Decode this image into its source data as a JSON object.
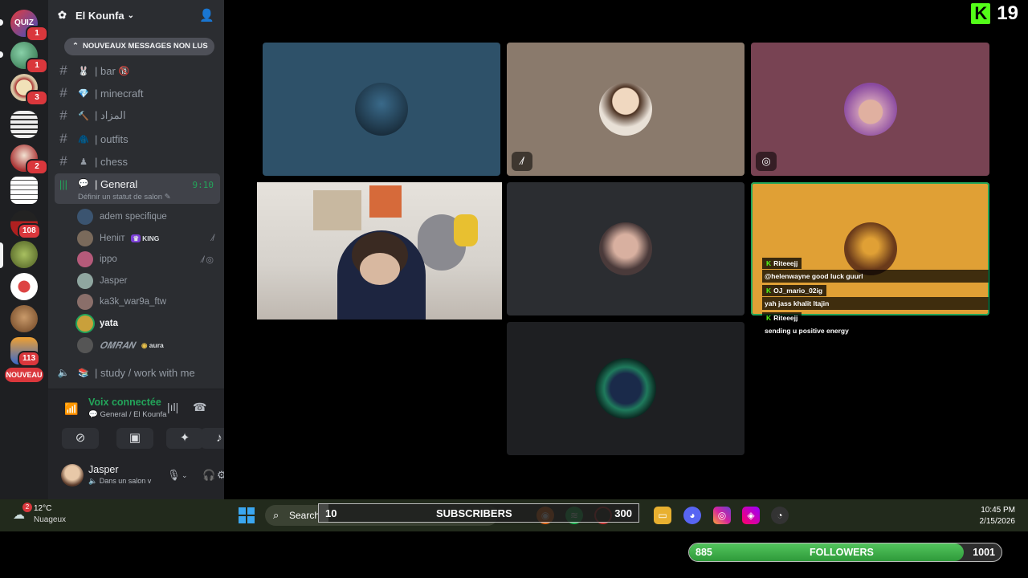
{
  "server_rail": {
    "badges": [
      "1",
      "1",
      "3",
      "2",
      "108",
      "113"
    ],
    "nouveau_label": "NOUVEAU",
    "quiz_label": "QUIZ"
  },
  "server": {
    "name": "El Kounfa",
    "unread_banner": "NOUVEAUX MESSAGES NON LUS"
  },
  "channels": [
    {
      "name": "| bar",
      "emoji": "🐰",
      "badge_emoji": "🔞"
    },
    {
      "name": "| minecraft",
      "emoji": "💎"
    },
    {
      "name": "| المزاد",
      "emoji": "🔨"
    },
    {
      "name": "| outfits",
      "emoji": "🧥"
    },
    {
      "name": "| chess",
      "emoji": "♟"
    }
  ],
  "voice_channel": {
    "name": "| General",
    "timer": "9:10",
    "status_hint": "Définir un statut de salon",
    "members": [
      {
        "name": "adem specifique",
        "color": "#3b5470"
      },
      {
        "name": "Heniιт",
        "tag": "KING",
        "color": "#7a6a5b"
      },
      {
        "name": "ippo",
        "color": "#b55a7a"
      },
      {
        "name": "Jasper",
        "color": "#8fa6a0"
      },
      {
        "name": "ka3k_war9a_ftw",
        "color": "#8a6f6a"
      },
      {
        "name": "yata",
        "color": "#c9a03b"
      },
      {
        "name": "𝑶𝑴𝑹𝑨𝑵",
        "tag": "aura",
        "color": "#555555"
      }
    ]
  },
  "other_voice": {
    "name": "| study / work with me"
  },
  "voice_panel": {
    "status": "Voix connectée",
    "sub": "General / El Kounfa"
  },
  "user_panel": {
    "name": "Jasper",
    "status": "Dans un salon v"
  },
  "stream": {
    "kick_number": "19",
    "chat": [
      {
        "user": "Riteeejj",
        "message": "@helenwayne good luck guurl"
      },
      {
        "user": "OJ_mario_02ig",
        "message": "yah jass khalit ltajin"
      },
      {
        "user": "Riteeejj",
        "message": "sending u positive energy"
      }
    ]
  },
  "tiles": [
    {
      "bg": "#2e5169",
      "avatar": "#1c2d3c"
    },
    {
      "bg": "#8a7a6c",
      "avatar": "#c8b8a6",
      "muted": true
    },
    {
      "bg": "#784353",
      "avatar": "#c792b6",
      "muted": true
    },
    {
      "bg": "#d6d2cc",
      "webcam": true
    },
    {
      "bg": "#2b2d31",
      "avatar": "#6a5a52"
    },
    {
      "bg": "#e0a035",
      "avatar": "#b07a2a",
      "speaking": true
    },
    {
      "bg": "#1e1f22",
      "avatar": "#1f7a5c"
    }
  ],
  "taskbar": {
    "temp": "12°C",
    "condition": "Nuageux",
    "weather_badge": "2",
    "search": "Search",
    "time": "10:45 PM",
    "date": "2/15/2026"
  },
  "subscribers_goal": {
    "current": "10",
    "label": "SUBSCRIBERS",
    "target": "300",
    "progress": 0.03
  },
  "followers_goal": {
    "current": "885",
    "label": "FOLLOWERS",
    "target": "1001",
    "progress": 0.88
  },
  "colors": {
    "accent": "#53fc18",
    "voice_green": "#23a55a",
    "badge_red": "#da373c"
  }
}
